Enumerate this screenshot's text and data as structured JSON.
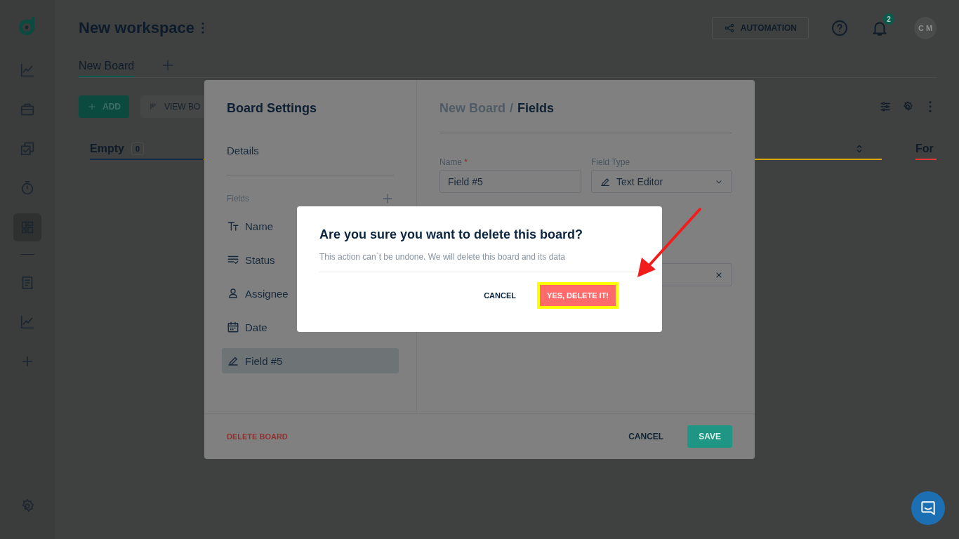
{
  "sidebar": {
    "items": [
      {
        "kind": "chart",
        "selected": false
      },
      {
        "kind": "briefcase",
        "selected": false
      },
      {
        "kind": "tasks",
        "selected": false
      },
      {
        "kind": "timer",
        "selected": false
      },
      {
        "kind": "board",
        "selected": true
      }
    ],
    "more_items": [
      {
        "kind": "document",
        "selected": false
      },
      {
        "kind": "chart",
        "selected": false
      },
      {
        "kind": "add",
        "selected": false
      }
    ]
  },
  "header": {
    "title": "New workspace",
    "automation": "AUTOMATION",
    "notifications": "2",
    "avatar": "C M"
  },
  "tabs": [
    {
      "label": "New Board",
      "selected": true
    }
  ],
  "toolbar": {
    "add": "ADD",
    "view": "VIEW BO"
  },
  "columns": [
    {
      "title": "Empty",
      "count": "0",
      "color": "#0f2a45"
    },
    {
      "color": "#d9a400"
    },
    {
      "title": "For",
      "color": "#e53935"
    }
  ],
  "board_settings": {
    "title": "Board Settings",
    "details": "Details",
    "fields_label": "Fields",
    "fields": [
      {
        "kind": "text",
        "label": "Name",
        "selected": false
      },
      {
        "kind": "status",
        "label": "Status",
        "selected": false
      },
      {
        "kind": "person",
        "label": "Assignee",
        "selected": false
      },
      {
        "kind": "date",
        "label": "Date",
        "selected": false
      },
      {
        "kind": "pen",
        "label": "Field #5",
        "selected": true
      }
    ],
    "breadcrumb": {
      "parent": "New Board",
      "separator": "/",
      "current": "Fields"
    },
    "name_label": "Name",
    "required_mark": "*",
    "name_value": "Field #5",
    "type_label": "Field Type",
    "type_value": "Text Editor",
    "delete": "DELETE BOARD",
    "cancel": "CANCEL",
    "save": "SAVE"
  },
  "confirm": {
    "title": "Are you sure you want to delete this board?",
    "message": "This action can`t be undone. We will delete this board and its data",
    "cancel": "CANCEL",
    "confirm": "YES, DELETE IT!",
    "highlighted": true
  }
}
